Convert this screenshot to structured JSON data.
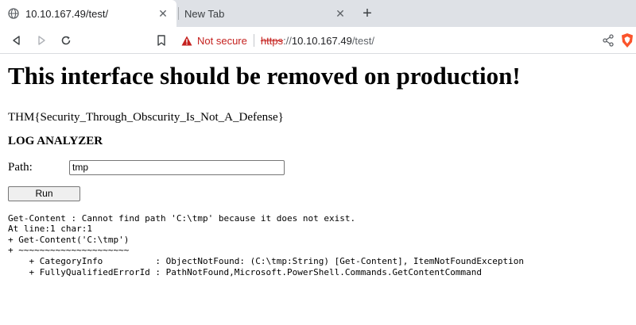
{
  "browser": {
    "tabs": [
      {
        "title": "10.10.167.49/test/",
        "active": true
      },
      {
        "title": "New Tab",
        "active": false
      }
    ],
    "security_label": "Not secure",
    "url": {
      "scheme": "https",
      "separator": "://",
      "host": "10.10.167.49",
      "path": "/test/"
    },
    "accent_warning": "#c5221f"
  },
  "page": {
    "heading": "This interface should be removed on production!",
    "flag": "THM{Security_Through_Obscurity_Is_Not_A_Defense}",
    "section_title": "LOG ANALYZER",
    "path_label": "Path:",
    "path_value": "tmp",
    "run_label": "Run",
    "output_lines": [
      "Get-Content : Cannot find path 'C:\\tmp' because it does not exist.",
      "At line:1 char:1",
      "+ Get-Content('C:\\tmp')",
      "+ ~~~~~~~~~~~~~~~~~~~~~",
      "    + CategoryInfo          : ObjectNotFound: (C:\\tmp:String) [Get-Content], ItemNotFoundException",
      "    + FullyQualifiedErrorId : PathNotFound,Microsoft.PowerShell.Commands.GetContentCommand"
    ]
  },
  "icons": {
    "favicon": "globe-icon",
    "tab_close": "close-icon",
    "new_tab": "plus-icon",
    "back": "back-icon",
    "forward": "forward-icon",
    "reload": "reload-icon",
    "bookmark": "bookmark-icon",
    "warning": "warning-icon",
    "share": "share-icon",
    "brave": "brave-shield-icon"
  }
}
